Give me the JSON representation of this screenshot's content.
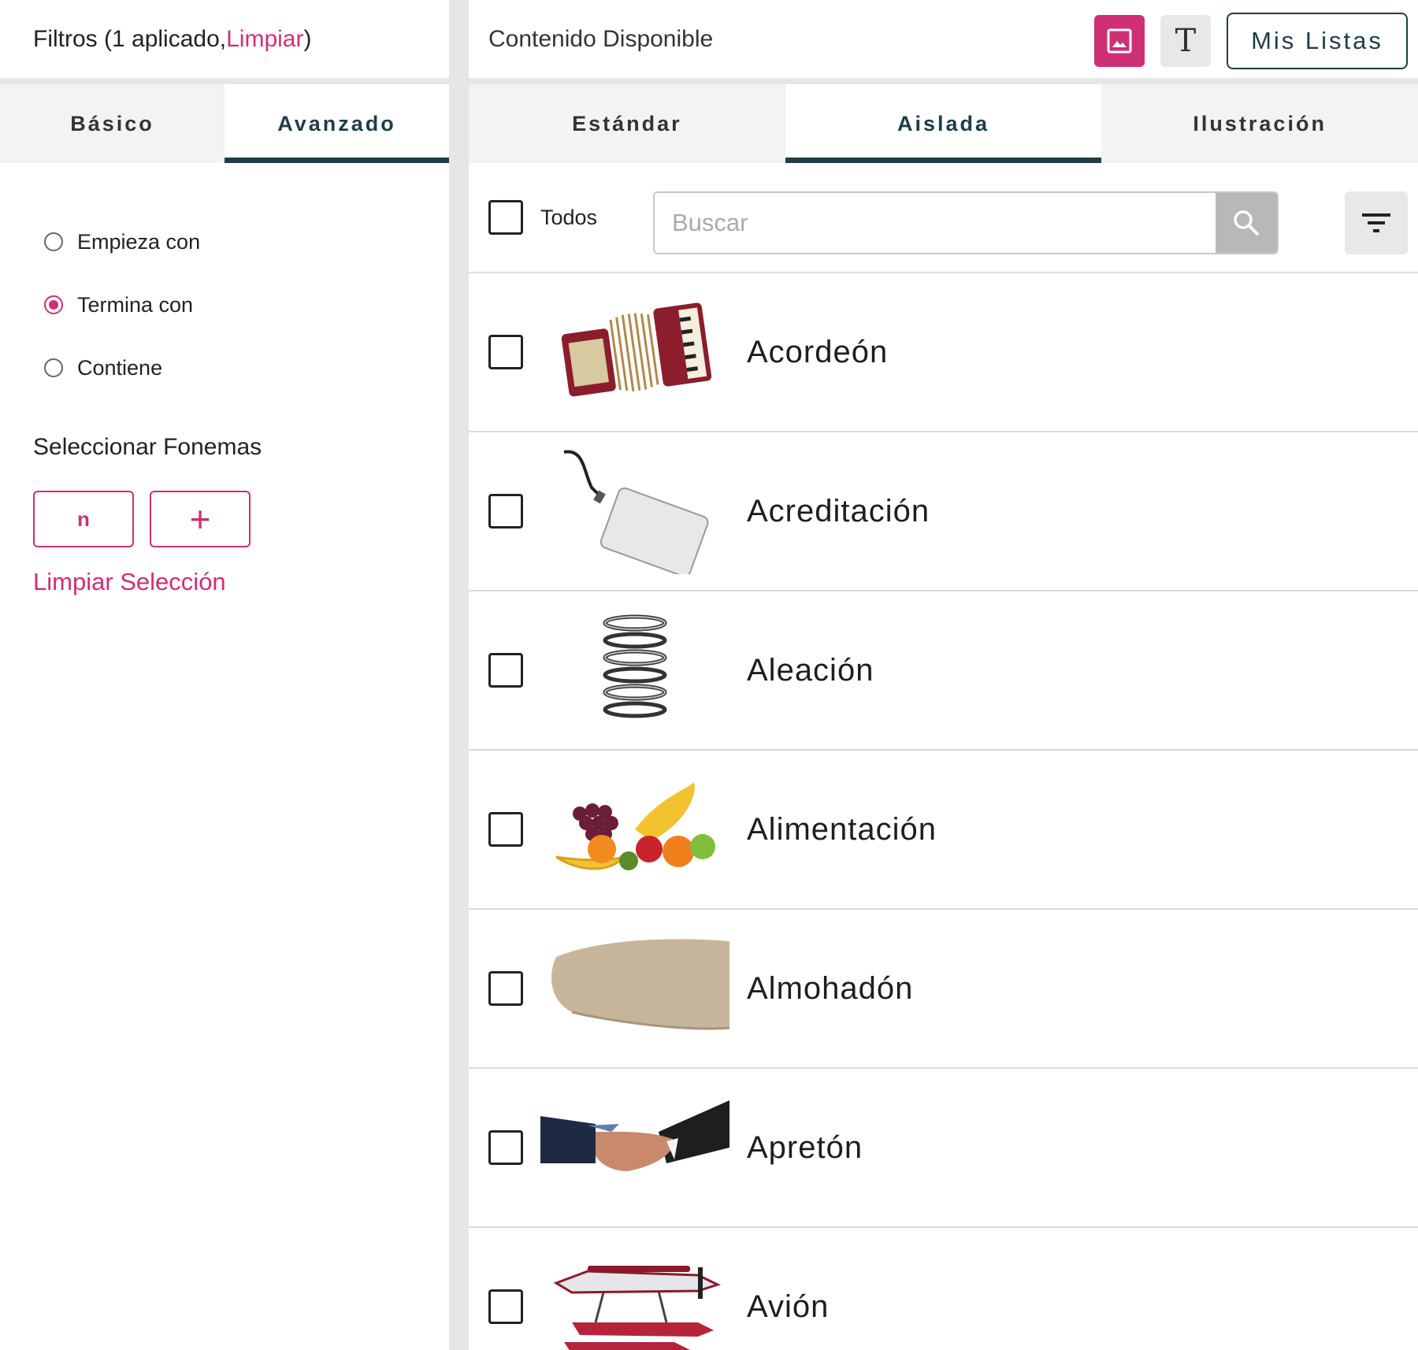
{
  "filters": {
    "title_prefix": "Filtros (1 aplicado, ",
    "clear_link": "Limpiar",
    "title_suffix": ")",
    "tabs": [
      {
        "label": "Básico"
      },
      {
        "label": "Avanzado"
      }
    ],
    "active_tab": "Avanzado",
    "options": [
      {
        "label": "Empieza con",
        "selected": false
      },
      {
        "label": "Termina con",
        "selected": true
      },
      {
        "label": "Contiene",
        "selected": false
      }
    ],
    "phonemes_title": "Seleccionar Fonemas",
    "phonemes": [
      "n"
    ],
    "add_symbol": "+",
    "clear_selection": "Limpiar Selección"
  },
  "content": {
    "title": "Contenido Disponible",
    "view_image_icon": "image-icon",
    "view_text_icon": "text-icon",
    "view_text_glyph": "T",
    "my_lists": "Mis Listas",
    "tabs": [
      {
        "label": "Estándar"
      },
      {
        "label": "Aislada"
      },
      {
        "label": "Ilustración"
      }
    ],
    "active_tab": "Aislada",
    "select_all": "Todos",
    "search_placeholder": "Buscar",
    "items": [
      {
        "label": "Acordeón",
        "image": "accordion"
      },
      {
        "label": "Acreditación",
        "image": "badge-lanyard"
      },
      {
        "label": "Aleación",
        "image": "metal-spring"
      },
      {
        "label": "Alimentación",
        "image": "fruit-pile"
      },
      {
        "label": "Almohadón",
        "image": "cushion"
      },
      {
        "label": "Apretón",
        "image": "handshake"
      },
      {
        "label": "Avión",
        "image": "seaplane"
      }
    ]
  },
  "colors": {
    "accent": "#cf2f74",
    "dark": "#1e3d47",
    "tab_bg": "#f2f3f4",
    "divider": "#e5e6e7"
  }
}
